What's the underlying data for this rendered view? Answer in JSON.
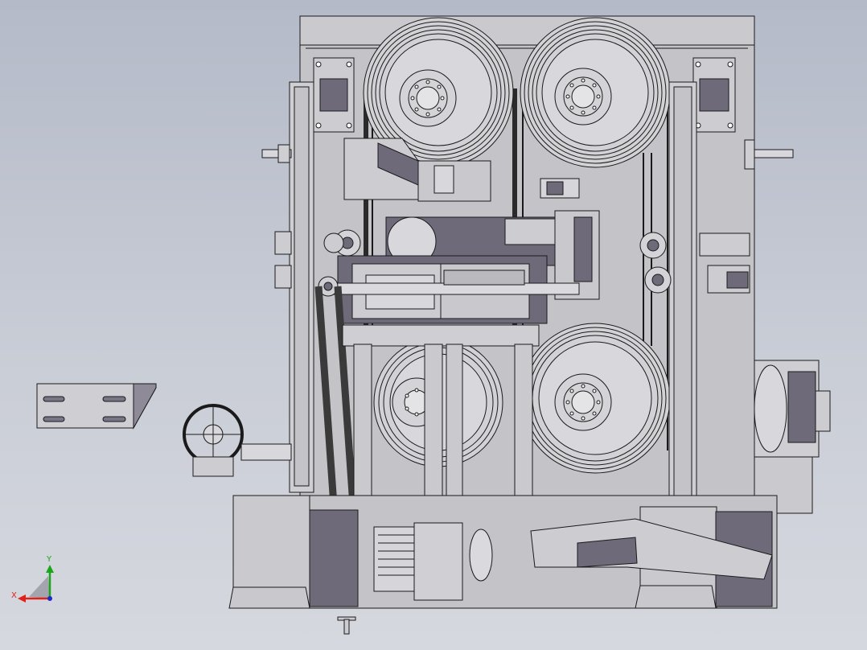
{
  "viewport": {
    "background_top": "#b4bac8",
    "background_bottom": "#d6d8df"
  },
  "model": {
    "body_color": "#c8c8cc",
    "shade_color": "#6f6a7a",
    "line_color": "#1a1a1a",
    "wheel_count": 4
  },
  "triad": {
    "x_label": "X",
    "y_label": "Y",
    "x_color": "#e0201a",
    "y_color": "#1aa51a",
    "z_color": "#1a2ad0"
  }
}
